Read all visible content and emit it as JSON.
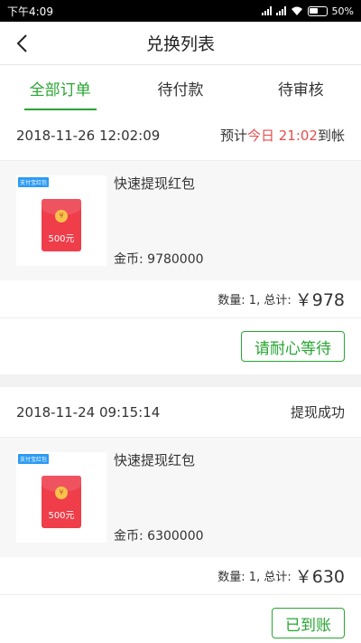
{
  "status_bar": {
    "time": "下午4:09",
    "battery": "50%"
  },
  "header": {
    "title": "兑换列表"
  },
  "tabs": [
    {
      "label": "全部订单",
      "active": true
    },
    {
      "label": "待付款",
      "active": false
    },
    {
      "label": "待审核",
      "active": false
    }
  ],
  "orders": [
    {
      "date": "2018-11-26 12:02:09",
      "status_prefix": "预计",
      "status_highlight": "今日 21:02",
      "status_suffix": "到帐",
      "tag": "支付宝红包",
      "envelope_amount": "500元",
      "product_name": "快速提现红包",
      "coins": "金币: 9780000",
      "qty_text": "数量: 1, 总计:",
      "total": "￥978",
      "action": "请耐心等待"
    },
    {
      "date": "2018-11-24 09:15:14",
      "status_text": "提现成功",
      "tag": "支付宝红包",
      "envelope_amount": "500元",
      "product_name": "快速提现红包",
      "coins": "金币: 6300000",
      "qty_text": "数量: 1, 总计:",
      "total": "￥630",
      "action": "已到账"
    }
  ],
  "colors": {
    "accent": "#27a532",
    "alert": "#e84d4d"
  }
}
